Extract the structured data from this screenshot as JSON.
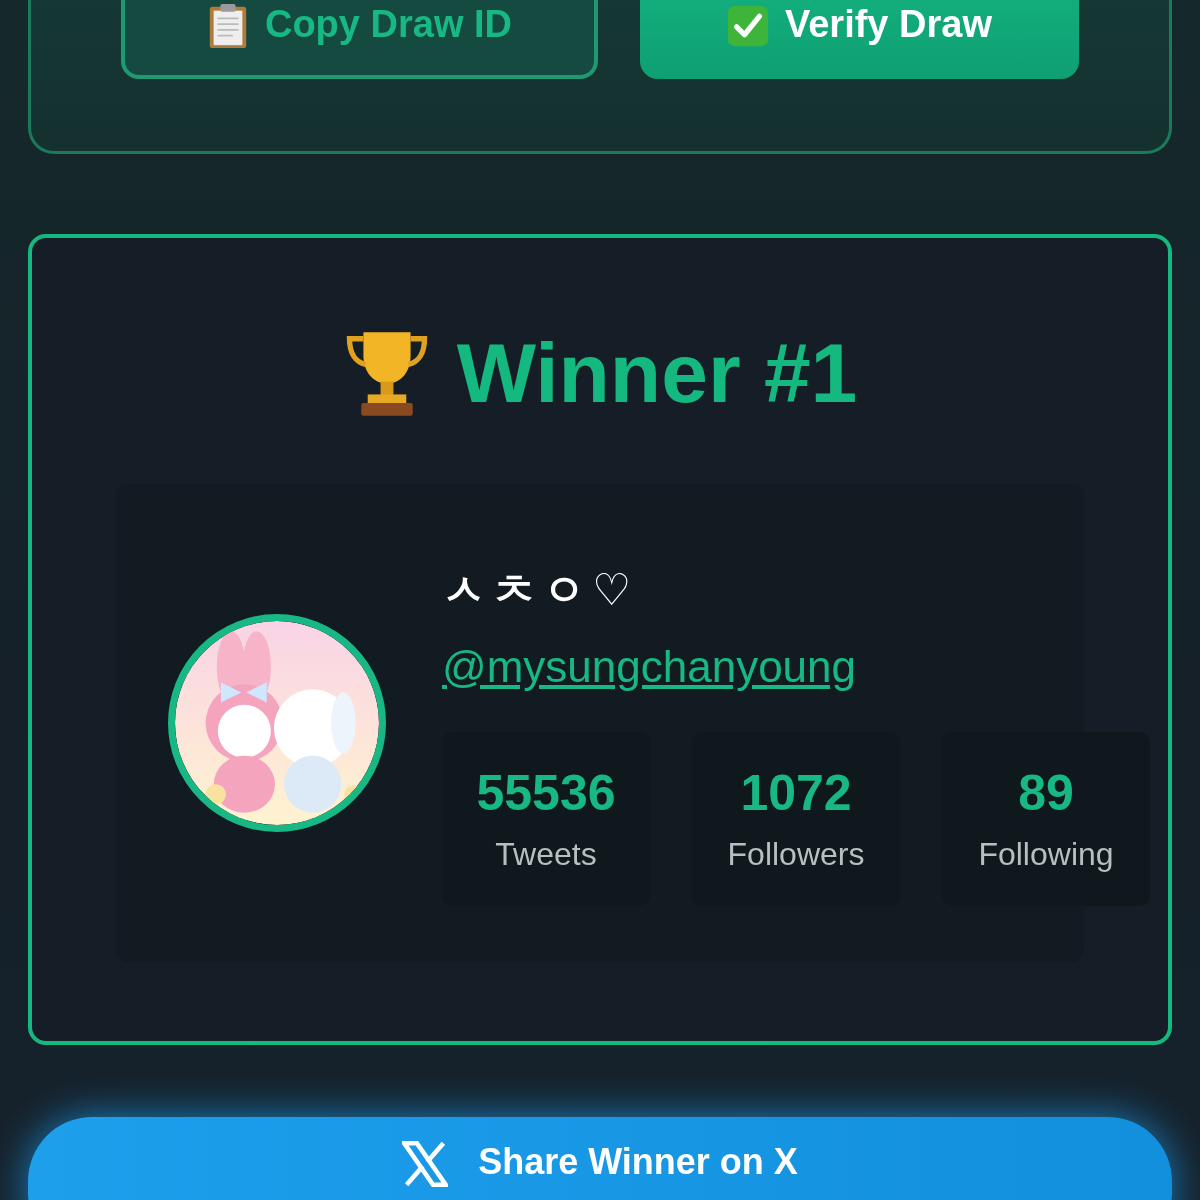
{
  "draw_actions": [
    {
      "label": "Copy Draw ID",
      "kind": "copy"
    },
    {
      "label": "Verify Draw",
      "kind": "verify"
    }
  ],
  "winner": {
    "title": "Winner #1",
    "name": "ㅅㅊㅇ♡",
    "handle": "@mysungchanyoung",
    "stats": [
      {
        "value": "55536",
        "label": "Tweets"
      },
      {
        "value": "1072",
        "label": "Followers"
      },
      {
        "value": "89",
        "label": "Following"
      }
    ]
  },
  "share_button": {
    "label": "Share Winner on X"
  }
}
